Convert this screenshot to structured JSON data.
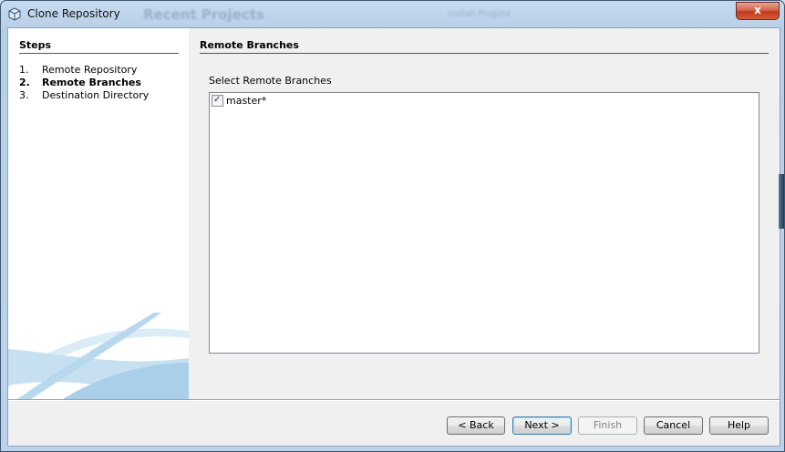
{
  "window": {
    "title": "Clone Repository",
    "close_label": "x",
    "background_text_1": "Recent Projects",
    "background_text_2": "Install Plugins"
  },
  "steps": {
    "heading": "Steps",
    "items": [
      {
        "num": "1.",
        "label": "Remote Repository",
        "current": false
      },
      {
        "num": "2.",
        "label": "Remote Branches",
        "current": true
      },
      {
        "num": "3.",
        "label": "Destination Directory",
        "current": false
      }
    ]
  },
  "content": {
    "heading": "Remote Branches",
    "select_label": "Select Remote Branches",
    "branches": [
      {
        "label": "master*",
        "checked": true
      }
    ]
  },
  "buttons": {
    "back": "< Back",
    "next": "Next >",
    "finish": "Finish",
    "cancel": "Cancel",
    "help": "Help"
  }
}
